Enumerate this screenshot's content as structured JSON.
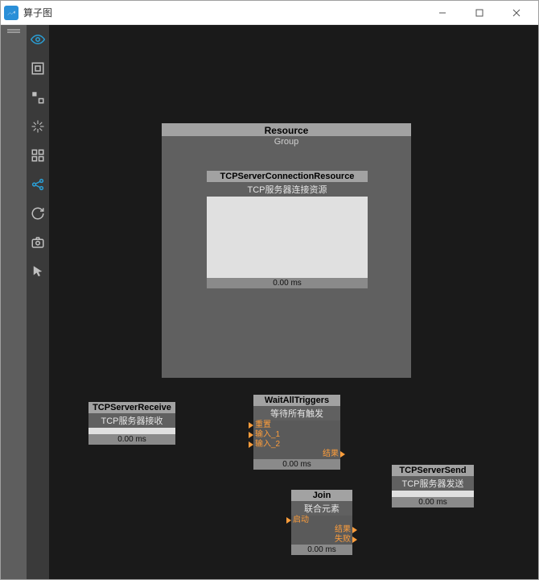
{
  "window": {
    "title": "算子图",
    "controls": {
      "min": "minimize",
      "max": "maximize",
      "close": "close"
    }
  },
  "toolbar": [
    {
      "name": "eye-icon",
      "active": true
    },
    {
      "name": "bounding-box-icon",
      "active": false
    },
    {
      "name": "connector-icon",
      "active": false
    },
    {
      "name": "snap-icon",
      "active": false
    },
    {
      "name": "grid-icon",
      "active": false
    },
    {
      "name": "share-icon",
      "active": false,
      "accent": true
    },
    {
      "name": "refresh-icon",
      "active": false
    },
    {
      "name": "camera-icon",
      "active": false
    },
    {
      "name": "cursor-icon",
      "active": false
    }
  ],
  "nodes": {
    "resourceGroup": {
      "title": "Resource",
      "subtitle": "Group"
    },
    "tcpConn": {
      "title": "TCPServerConnectionResource",
      "subtitle": "TCP服务器连接资源",
      "time": "0.00 ms"
    },
    "tcpReceive": {
      "title": "TCPServerReceive",
      "subtitle": "TCP服务器接收",
      "time": "0.00 ms"
    },
    "waitAll": {
      "title": "WaitAllTriggers",
      "subtitle": "等待所有触发",
      "ports": {
        "reset": "重置",
        "in1": "输入_1",
        "in2": "输入_2",
        "out": "结果"
      },
      "time": "0.00 ms"
    },
    "tcpSend": {
      "title": "TCPServerSend",
      "subtitle": "TCP服务器发送",
      "time": "0.00 ms"
    },
    "join": {
      "title": "Join",
      "subtitle": "联合元素",
      "ports": {
        "start": "启动",
        "result": "结果",
        "fail": "失败"
      },
      "time": "0.00 ms"
    }
  }
}
